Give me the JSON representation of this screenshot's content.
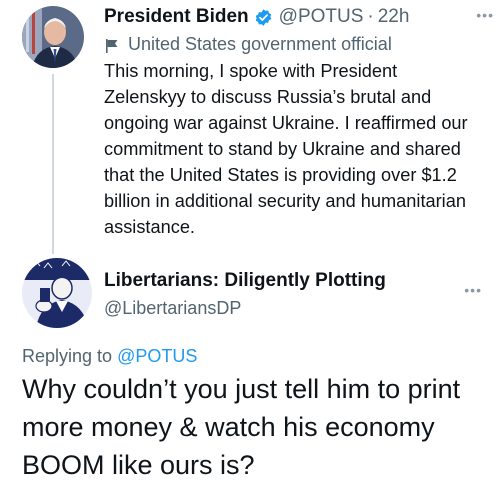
{
  "tweet1": {
    "display_name": "President Biden",
    "handle": "@POTUS",
    "separator": "·",
    "time": "22h",
    "label": "United States government official",
    "text": "This morning, I spoke with President Zelenskyy to discuss Russia’s brutal and ongoing war against Ukraine. I reaffirmed our commitment to stand by Ukraine and shared that the United States is providing over $1.2 billion in additional security and humanitarian assistance.",
    "more_label": "•••"
  },
  "tweet2": {
    "display_name": "Libertarians: Diligently Plotting",
    "handle": "@LibertariansDP",
    "more_label": "•••",
    "replying_prefix": "Replying to",
    "replying_to": "@POTUS",
    "text": "Why couldn’t you just tell him to print more money & watch his economy BOOM like ours is?"
  },
  "colors": {
    "verified_blue": "#1d9bf0",
    "secondary_text": "#536471",
    "link_blue": "#1d9bf0"
  },
  "icons": {
    "verified": "verified-badge-icon",
    "gov_label": "flag-icon",
    "more": "more-options-icon"
  }
}
